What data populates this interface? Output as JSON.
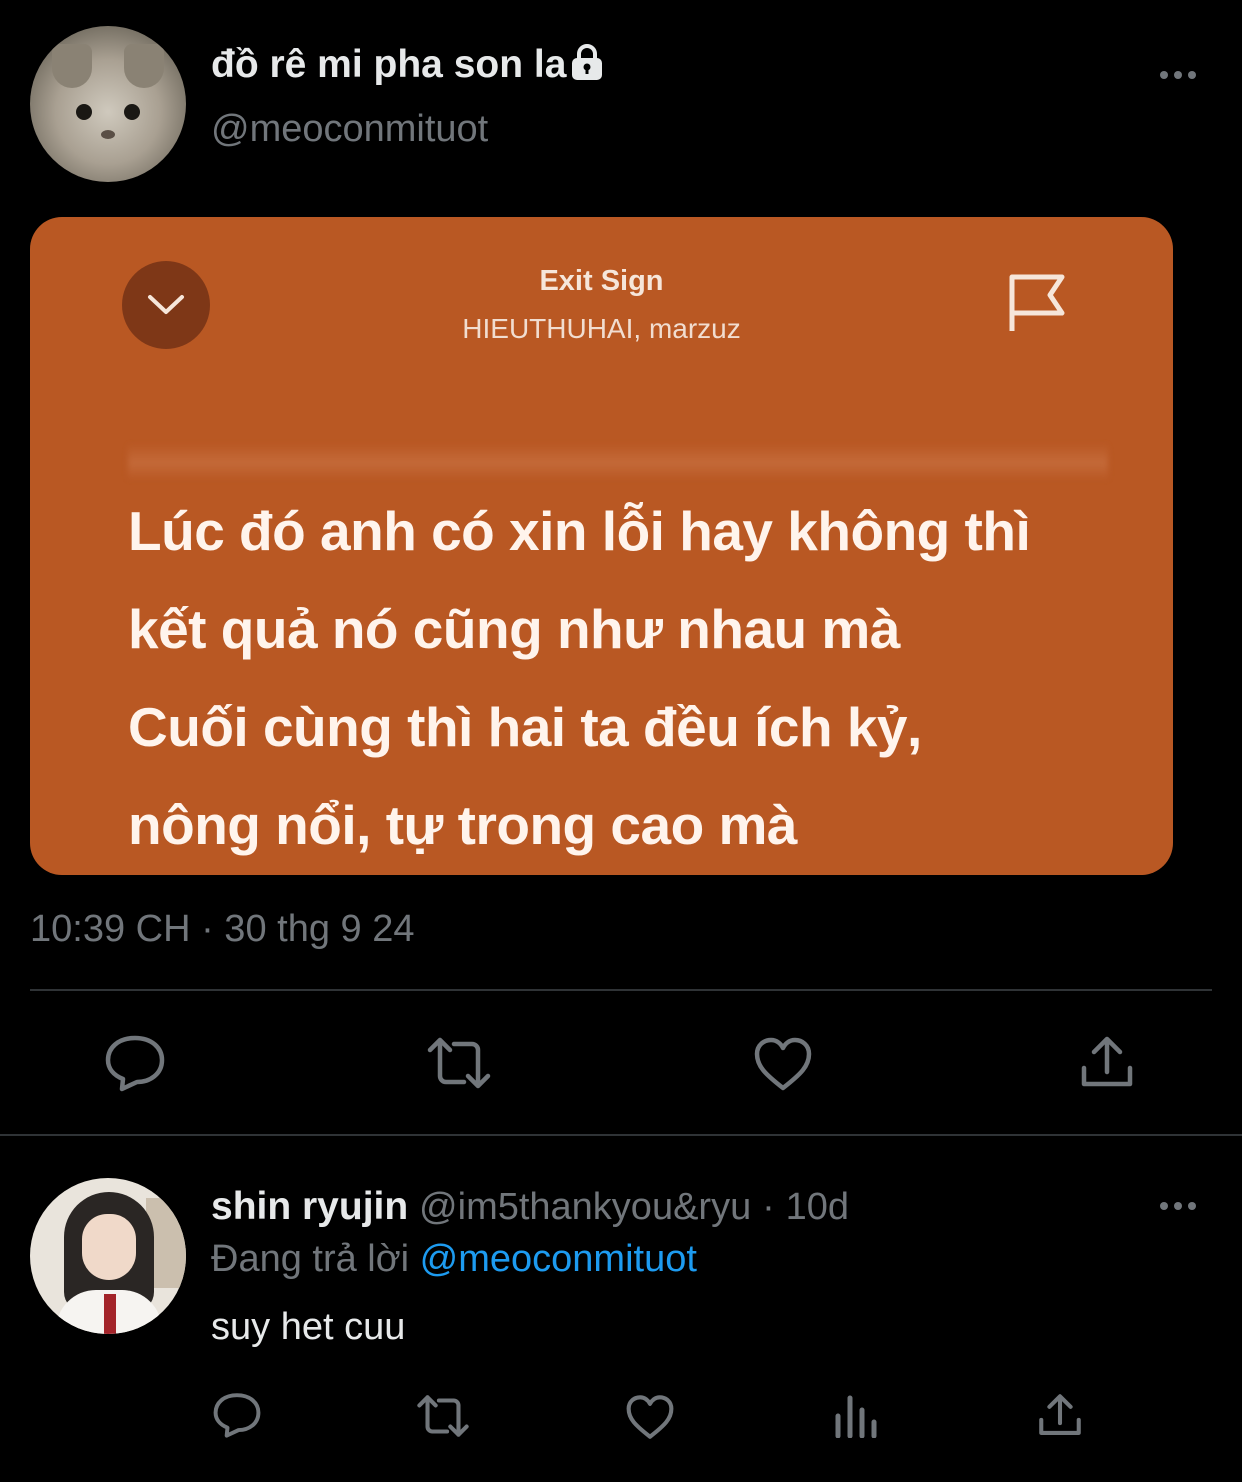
{
  "main_tweet": {
    "display_name": "đồ rê mi pha son la",
    "handle": "@meoconmituot",
    "timestamp": "10:39 CH · 30 thg 9 24",
    "locked_icon": "lock-icon",
    "lyrics_card": {
      "song_title": "Exit Sign",
      "artists": "HIEUTHUHAI, marzuz",
      "lines": [
        "Lúc đó anh có xin lỗi hay không thì",
        "kết quả nó cũng như nhau mà",
        "Cuối cùng thì hai ta đều ích kỷ,",
        "nông nổi, tự trong cao mà"
      ],
      "background_color": "#b95823"
    },
    "actions": [
      "reply-icon",
      "retweet-icon",
      "like-icon",
      "share-icon"
    ]
  },
  "reply": {
    "display_name": "shin ryujin",
    "handle": "@im5thankyou&ryu",
    "separator": "·",
    "time": "10d",
    "replying_label": "Đang trả lời",
    "replying_to": "@meoconmituot",
    "text": "suy het cuu",
    "actions": [
      "reply-icon",
      "retweet-icon",
      "like-icon",
      "views-icon",
      "share-icon"
    ]
  },
  "colors": {
    "background": "#000000",
    "text_primary": "#e7e9ea",
    "text_secondary": "#71767b",
    "link": "#1d9bf0",
    "divider": "#2f3336"
  }
}
